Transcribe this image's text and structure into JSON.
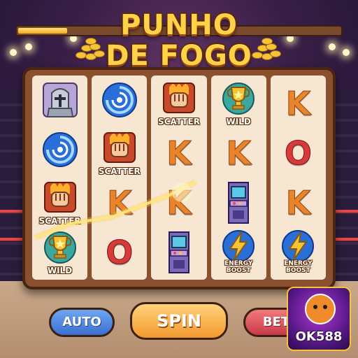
{
  "game": {
    "title_line1": "PUNHO",
    "title_line2": "DE FOGO",
    "progress_fraction": 0.15
  },
  "reels": [
    [
      {
        "kind": "icon",
        "icon": "knight-helmet-icon",
        "label": ""
      },
      {
        "kind": "icon",
        "icon": "blue-vortex-icon",
        "label": ""
      },
      {
        "kind": "icon",
        "icon": "flaming-fist-icon",
        "label": "SCATTER"
      },
      {
        "kind": "icon",
        "icon": "trophy-icon",
        "label": "WILD"
      }
    ],
    [
      {
        "kind": "icon",
        "icon": "blue-vortex-icon",
        "label": ""
      },
      {
        "kind": "icon",
        "icon": "flaming-fist-icon",
        "label": "SCATTER"
      },
      {
        "kind": "letter",
        "letter": "K",
        "color": "orange"
      },
      {
        "kind": "letter",
        "letter": "O",
        "color": "red"
      }
    ],
    [
      {
        "kind": "icon",
        "icon": "flaming-fist-icon",
        "label": "SCATTER"
      },
      {
        "kind": "letter",
        "letter": "K",
        "color": "orange"
      },
      {
        "kind": "letter",
        "letter": "K",
        "color": "orange"
      },
      {
        "kind": "icon",
        "icon": "arcade-cabinet-icon",
        "label": ""
      }
    ],
    [
      {
        "kind": "icon",
        "icon": "trophy-icon",
        "label": "WILD"
      },
      {
        "kind": "letter",
        "letter": "K",
        "color": "orange"
      },
      {
        "kind": "icon",
        "icon": "arcade-cabinet-icon",
        "label": ""
      },
      {
        "kind": "icon",
        "icon": "lightning-bolt-icon",
        "label": "ENERGY BOOST"
      }
    ],
    [
      {
        "kind": "letter",
        "letter": "K",
        "color": "orange"
      },
      {
        "kind": "letter",
        "letter": "O",
        "color": "red"
      },
      {
        "kind": "letter",
        "letter": "K",
        "color": "orange"
      },
      {
        "kind": "icon",
        "icon": "lightning-bolt-icon",
        "label": "ENERGY BOOST"
      }
    ]
  ],
  "controls": {
    "auto_label": "AUTO",
    "spin_label": "SPIN",
    "bet_label": "BET"
  },
  "logo": {
    "name": "OK588"
  },
  "colors": {
    "gold": "#ffd24a",
    "auto_blue": "#3a6fd0",
    "spin_orange": "#f19a2e",
    "bet_red": "#c83a4a",
    "k_orange": "#e8852a",
    "o_red": "#d83a3a"
  }
}
